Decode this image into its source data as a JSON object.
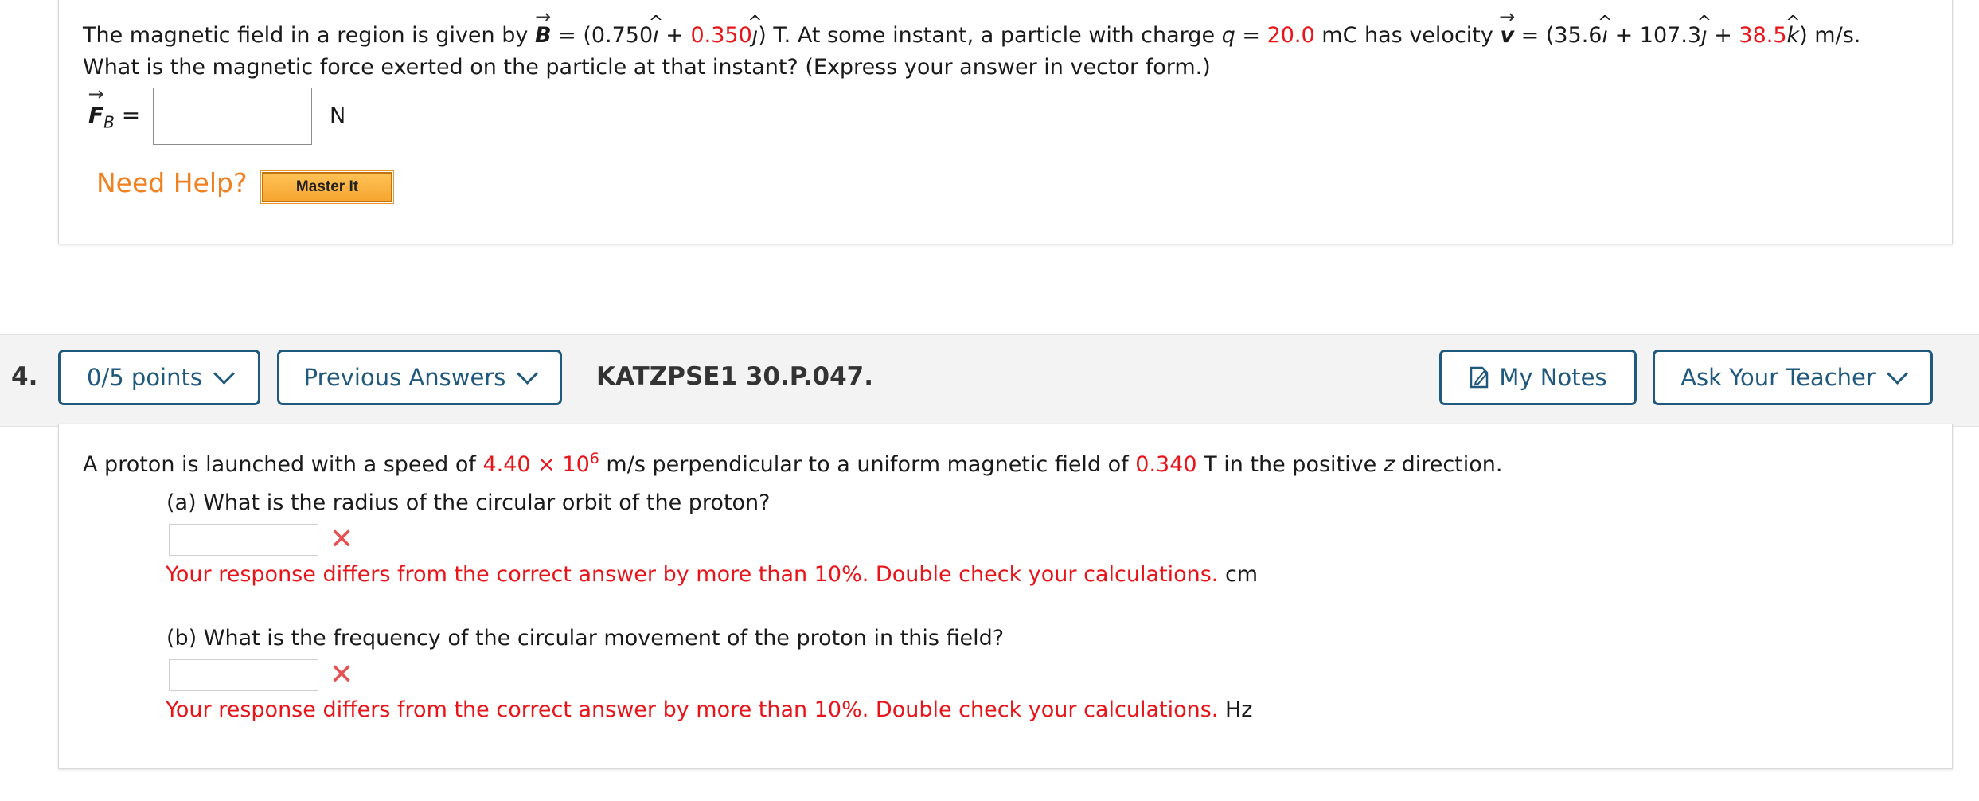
{
  "q3": {
    "line1": {
      "t1": "The magnetic field in a region is given by ",
      "B": "B",
      "t2": " = (0.750",
      "i1": "ı",
      "t3": " + ",
      "By": "0.350",
      "j1": "ȷ",
      "t4": ") T.  At some instant, a particle with charge  ",
      "q": "q",
      "t5": " = ",
      "qv": "20.0",
      "t6": " mC  has velocity  ",
      "v": "v",
      "t7": " = (35.6",
      "i2": "ı",
      "t8": " + 107.3",
      "j2": "ȷ",
      "t9": " + ",
      "vz": "38.5",
      "k": "k",
      "t10": ") m/s."
    },
    "line2": "What is the magnetic force exerted on the particle at that instant? (Express your answer in vector form.)",
    "answer_label_F": "F",
    "answer_label_sub": "B",
    "answer_label_eq": " =",
    "answer_unit": "N",
    "need_help": "Need Help?",
    "master_it": "Master It"
  },
  "q4": {
    "number": "4.",
    "points_label": "0/5 points",
    "previous_answers_label": "Previous Answers",
    "reference": "KATZPSE1 30.P.047.",
    "my_notes_label": "My Notes",
    "ask_teacher_label": "Ask Your Teacher",
    "intro": {
      "t1": "A proton is launched with a speed of ",
      "speed_mant": "4.40 × 10",
      "speed_exp": "6",
      "t2": " m/s perpendicular to a uniform magnetic field of ",
      "field": "0.340",
      "t3": " T in the positive ",
      "z": "z",
      "t4": " direction."
    },
    "part_a": {
      "question": "(a) What is the radius of the circular orbit of the proton?",
      "feedback": "Your response differs from the correct answer by more than 10%. Double check your calculations.",
      "unit": "cm"
    },
    "part_b": {
      "question": "(b) What is the frequency of the circular movement of the proton in this field?",
      "feedback": "Your response differs from the correct answer by more than 10%. Double check your calculations.",
      "unit": "Hz"
    }
  },
  "icons": {
    "incorrect": "x-mark-icon",
    "notes": "note-icon",
    "dropdown": "chevron-down-icon"
  },
  "colors": {
    "accent": "#20597e",
    "value_red": "#e8141a",
    "need_help": "#f08020",
    "error_x": "#e85050"
  }
}
